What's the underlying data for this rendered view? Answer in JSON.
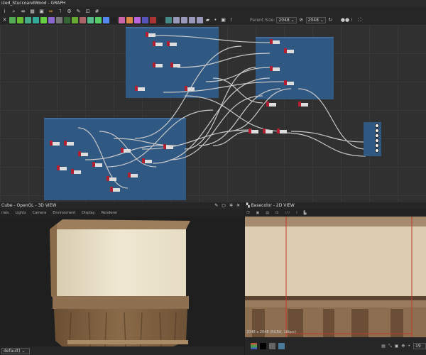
{
  "window_title": "ized_StuccoandWood - GRAPH",
  "toolbar": {
    "parent_size_label": "Parent Size:",
    "parent_size_value": "2048",
    "size_value": "2048",
    "node_colors": [
      "#5a5",
      "#6b3",
      "#4a8",
      "#3a9",
      "#6c4",
      "#86c",
      "#777",
      "#363",
      "#6a3",
      "#a66",
      "#5b8",
      "#5c6",
      "#58e",
      "#222",
      "#c6a",
      "#d84",
      "#b6d",
      "#55b",
      "#a33",
      "#222",
      "#488",
      "#99b",
      "#99b",
      "#99b",
      "#99b"
    ]
  },
  "view3d": {
    "title": "Cube - OpenGL - 3D VIEW",
    "menu": [
      "rials",
      "Lights",
      "Camera",
      "Environment",
      "Display",
      "Renderer"
    ],
    "preset": "default)"
  },
  "view2d": {
    "title": "Basecolor - 2D VIEW",
    "uv_label": "UV",
    "resolution": "2048 x 2048 (RGBA, 16bpc)",
    "zoom": "19"
  },
  "colors": {
    "frame": "#2f5883",
    "wire": "#c8c8c8",
    "highlight_wire": "#f0a020",
    "guide": "#c0392b"
  }
}
